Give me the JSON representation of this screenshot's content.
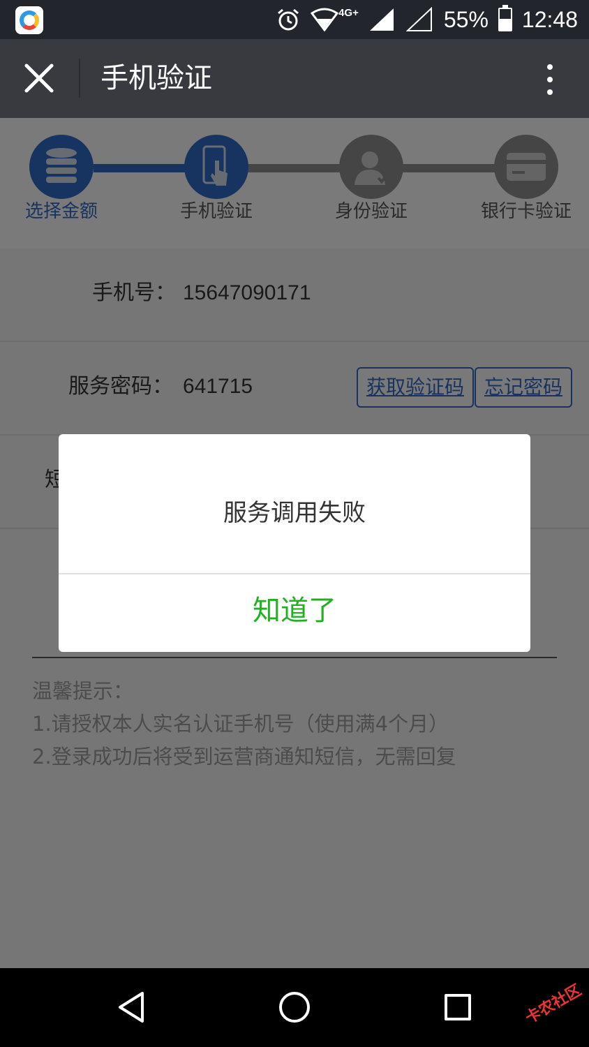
{
  "status_bar": {
    "network": "4G+",
    "battery": "55%",
    "battery_level": 0.55,
    "time": "12:48"
  },
  "title_bar": {
    "title": "手机验证"
  },
  "steps": [
    {
      "label": "选择金额",
      "state": "active",
      "icon": "coins-stack-icon"
    },
    {
      "label": "手机验证",
      "state": "current",
      "icon": "phone-touch-icon"
    },
    {
      "label": "身份验证",
      "state": "pending",
      "icon": "user-verify-icon"
    },
    {
      "label": "银行卡验证",
      "state": "pending",
      "icon": "bank-card-icon"
    }
  ],
  "form": {
    "phone_label": "手机号：",
    "phone_value": "15647090171",
    "password_label": "服务密码：",
    "password_value": "641715",
    "get_code_label": "获取验证码",
    "forgot_label": "忘记密码",
    "sms_label_partial": "短"
  },
  "tips": {
    "title": "温馨提示：",
    "lines": [
      "1.请授权本人实名认证手机号（使用满4个月）",
      "2.登录成功后将受到运营商通知短信，无需回复"
    ]
  },
  "dialog": {
    "message": "服务调用失败",
    "button": "知道了"
  },
  "colors": {
    "title_bar": "#393a3f",
    "step_active": "#2e66c1",
    "step_pending": "#8a8a8a",
    "dialog_button": "#20b020"
  }
}
